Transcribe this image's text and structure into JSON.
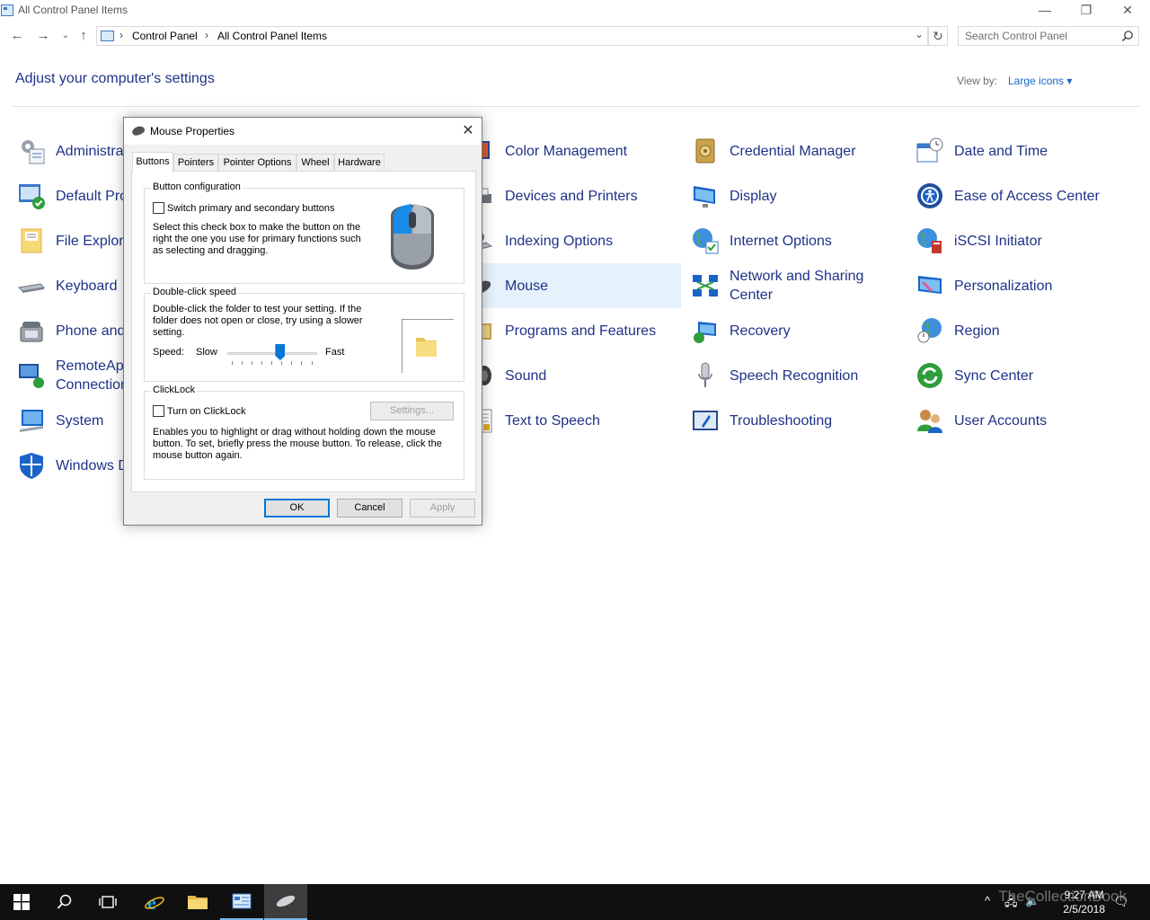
{
  "window": {
    "title": "All Control Panel Items",
    "minimize": "—",
    "restore": "❐",
    "close": "✕"
  },
  "address": {
    "crumbs": [
      "Control Panel",
      "All Control Panel Items"
    ],
    "separator": "›",
    "search_placeholder": "Search Control Panel"
  },
  "header": {
    "title": "Adjust your computer's settings",
    "view_by_label": "View by:",
    "view_by_value": "Large icons ▾"
  },
  "items": {
    "col1": [
      "Administrative Tools",
      "Default Programs",
      "File Explorer Options",
      "Keyboard",
      "Phone and Modem",
      "RemoteApp and Desktop Connections",
      "System",
      "Windows Defender Firewall"
    ],
    "col2": [
      "Color Management",
      "Devices and Printers",
      "Indexing Options",
      "Mouse",
      "Programs and Features",
      "Sound",
      "Text to Speech"
    ],
    "col3": [
      "Credential Manager",
      "Display",
      "Internet Options",
      "Network and Sharing Center",
      "Recovery",
      "Speech Recognition",
      "Troubleshooting"
    ],
    "col4": [
      "Date and Time",
      "Ease of Access Center",
      "iSCSI Initiator",
      "Personalization",
      "Region",
      "Sync Center",
      "User Accounts"
    ],
    "col1_visible": [
      "Administra",
      "Default Pro",
      "File Explore",
      "Keyboard",
      "Phone and",
      "RemoteApp\nConnection",
      "System",
      "Windows D"
    ]
  },
  "dialog": {
    "title": "Mouse Properties",
    "close": "✕",
    "tabs": [
      "Buttons",
      "Pointers",
      "Pointer Options",
      "Wheel",
      "Hardware"
    ],
    "button_config": {
      "legend": "Button configuration",
      "checkbox_label": "Switch primary and secondary buttons",
      "description_lines": [
        "Select this check box to make the button on the",
        "right the one you use for primary functions such",
        "as selecting and dragging."
      ]
    },
    "double_click": {
      "legend": "Double-click speed",
      "description_lines": [
        "Double-click the folder to test your setting. If the",
        "folder does not open or close, try using a slower",
        "setting."
      ],
      "speed_label": "Speed:",
      "slow": "Slow",
      "fast": "Fast",
      "speed_fraction": 0.6
    },
    "clicklock": {
      "legend": "ClickLock",
      "checkbox_label": "Turn on ClickLock",
      "settings_button": "Settings...",
      "description_lines": [
        "Enables you to highlight or drag without holding down the mouse",
        "button. To set, briefly press the mouse button. To release, click the",
        "mouse button again."
      ]
    },
    "buttons": {
      "ok": "OK",
      "cancel": "Cancel",
      "apply": "Apply"
    }
  },
  "taskbar": {
    "time": "9:27 AM",
    "date": "2/5/2018",
    "watermark": "TheCollectionBook"
  },
  "colors": {
    "link_blue": "#1e3287",
    "accent": "#0078d7",
    "highlight": "#e5f1fb",
    "taskbar": "#101010"
  }
}
